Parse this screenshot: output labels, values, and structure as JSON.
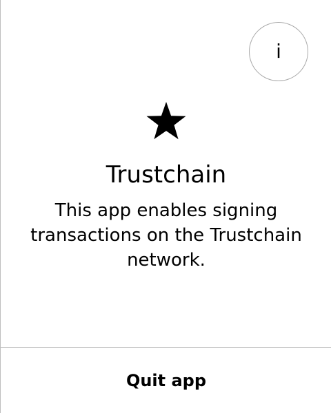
{
  "info_button": {
    "label": "i",
    "icon": "info-icon"
  },
  "app": {
    "icon": "star-icon",
    "name": "Trustchain",
    "description": "This app enables signing transactions on the Trustchain network."
  },
  "footer": {
    "quit_label": "Quit app"
  },
  "colors": {
    "background": "#ffffff",
    "text": "#000000",
    "border": "#a8a8a8",
    "divider": "#b5b5b5"
  }
}
